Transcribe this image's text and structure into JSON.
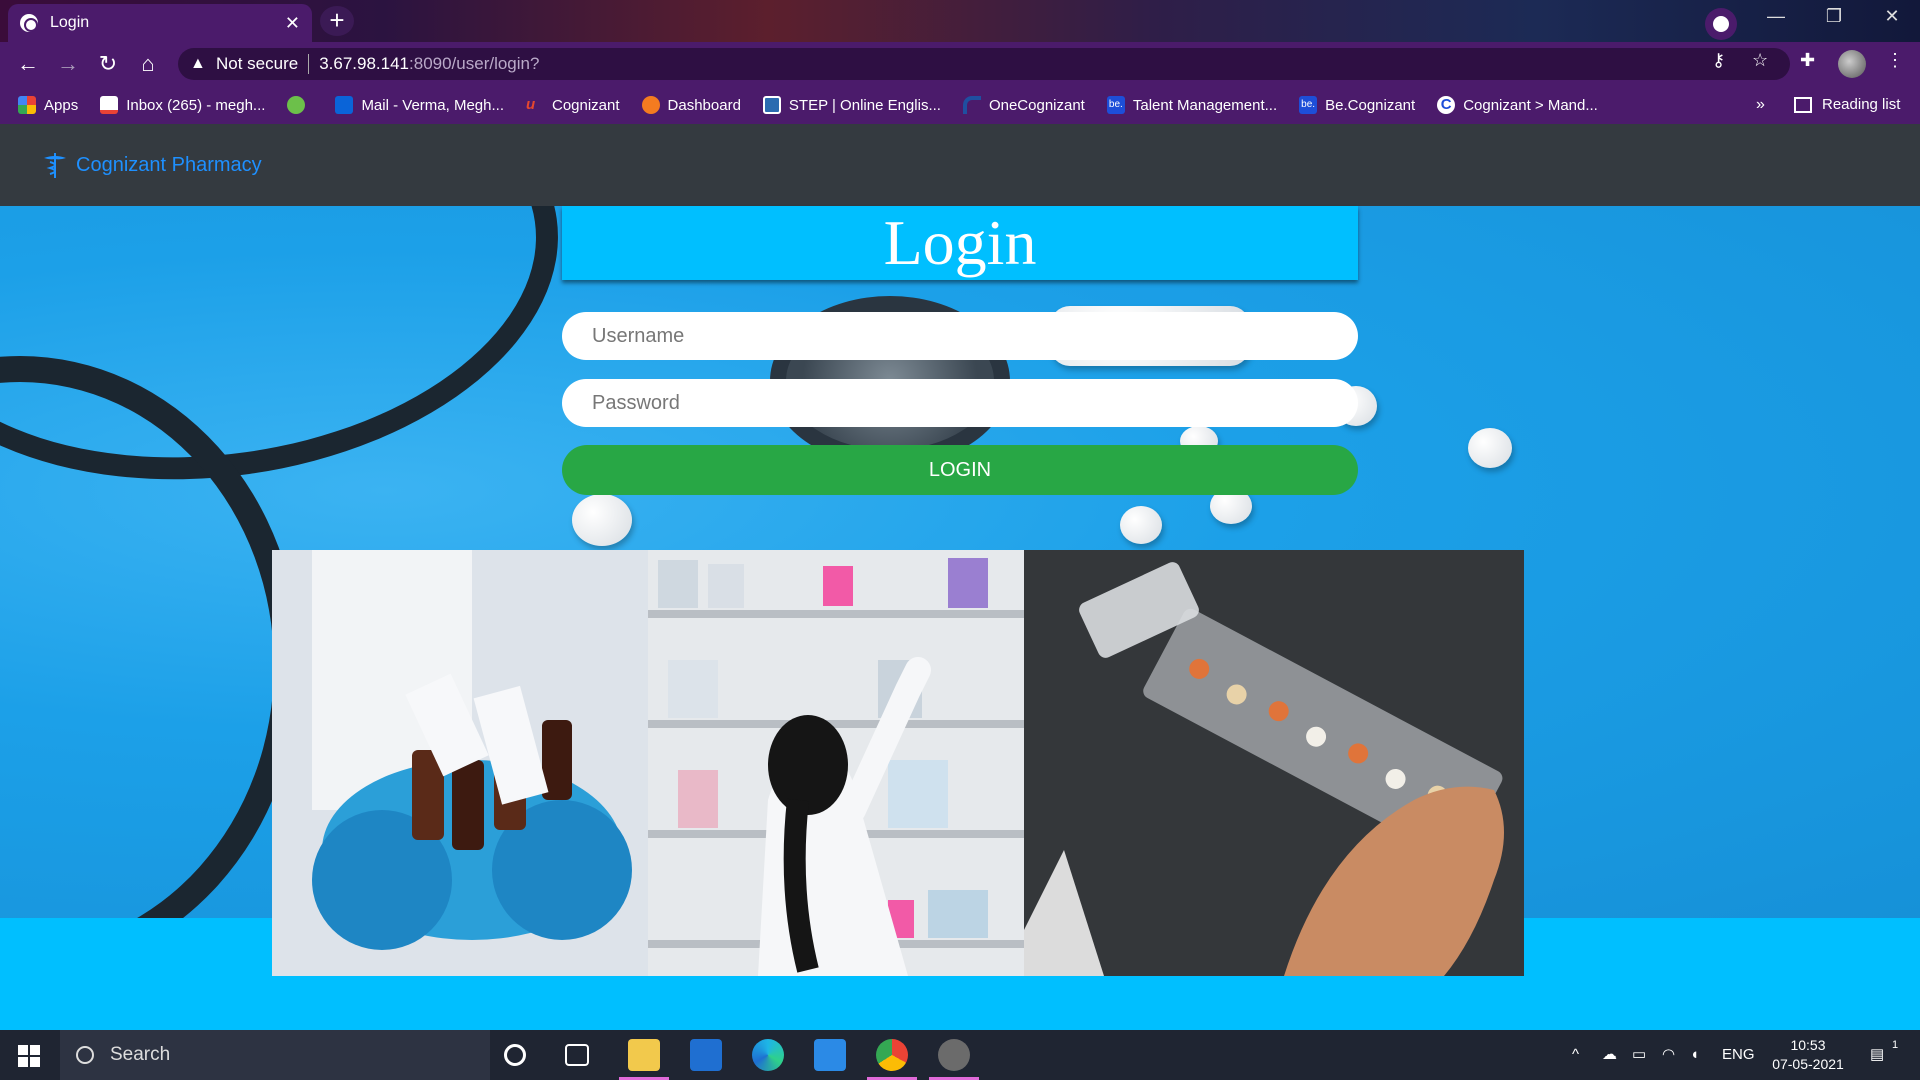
{
  "browser": {
    "tab_title": "Login",
    "tab_close": "✕",
    "new_tab": "+",
    "not_secure": "Not secure",
    "url_host": "3.67.98.141",
    "url_rest": ":8090/user/login?",
    "window_controls": [
      "—",
      "❐",
      "✕"
    ]
  },
  "bookmarks": {
    "items": [
      {
        "label": "Apps",
        "icon": "apps-grid-icon",
        "color": "#ea4335"
      },
      {
        "label": "Inbox (265) - megh...",
        "icon": "gmail-icon",
        "color": "#ea4335"
      },
      {
        "label": "",
        "icon": "green-leaf-icon",
        "color": "#6cc04a"
      },
      {
        "label": "Mail - Verma, Megh...",
        "icon": "outlook-icon",
        "color": "#0a64d8"
      },
      {
        "label": "Cognizant",
        "icon": "cognizant-script-icon",
        "color": "#e5482e"
      },
      {
        "label": "Dashboard",
        "icon": "dashboard-icon",
        "color": "#f47b20"
      },
      {
        "label": "STEP | Online Englis...",
        "icon": "step-icon",
        "color": "#2b6cb0"
      },
      {
        "label": "OneCognizant",
        "icon": "onecognizant-icon",
        "color": "#1f4fa0"
      },
      {
        "label": "Talent Management...",
        "icon": "be-icon",
        "color": "#1d4ed8"
      },
      {
        "label": "Be.Cognizant",
        "icon": "be-icon",
        "color": "#1d4ed8"
      },
      {
        "label": "Cognizant > Mand...",
        "icon": "cognizant-c-icon",
        "color": "#1d4ed8"
      }
    ],
    "more": "»",
    "reading_list": "Reading list"
  },
  "page": {
    "brand": "Cognizant Pharmacy",
    "login_title": "Login",
    "username_placeholder": "Username",
    "password_placeholder": "Password",
    "login_button": "LOGIN",
    "gallery": [
      "medicine-in-gloved-hands-photo",
      "pharmacist-at-shelves-photo",
      "pill-organizer-photo"
    ]
  },
  "taskbar": {
    "search_label": "Search",
    "language": "ENG",
    "time": "10:53",
    "date": "07-05-2021",
    "notifications": "1"
  },
  "colors": {
    "chrome": "#4b1b6b",
    "navbar": "#343a40",
    "accent": "#00bfff",
    "login_green": "#28a745",
    "brand_blue": "#1e90ff"
  }
}
